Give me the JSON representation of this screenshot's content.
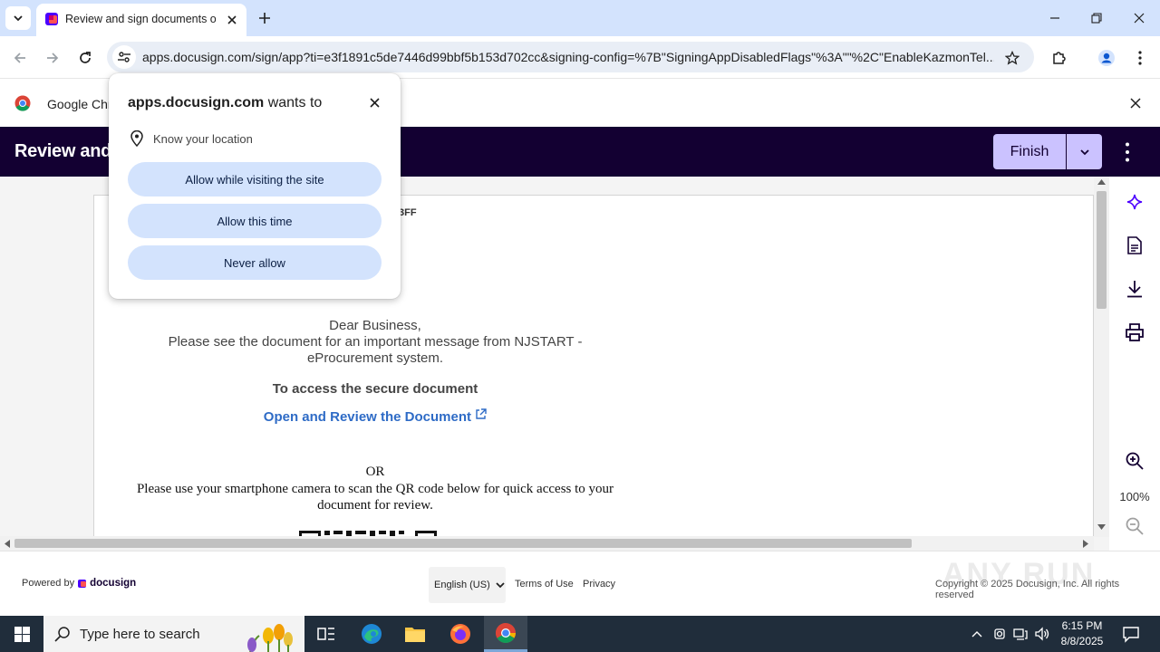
{
  "browser": {
    "tab": {
      "title": "Review and sign documents on"
    },
    "url": "apps.docusign.com/sign/app?ti=e3f1891c5de7446d99bbf5b153d702cc&signing-config=%7B\"SigningAppDisabledFlags\"%3A\"\"%2C\"EnableKazmonTel...",
    "infobar": {
      "text": "Google Chrome"
    }
  },
  "permission_popup": {
    "domain": "apps.docusign.com",
    "wants_to": " wants to",
    "permission": "Know your location",
    "buttons": {
      "allow_visiting": "Allow while visiting the site",
      "allow_once": "Allow this time",
      "never": "Never allow"
    }
  },
  "docusign": {
    "header_title": "Review and sign documents",
    "finish_label": "Finish",
    "document": {
      "code_fragment": "3FF",
      "greeting": "Dear Business,",
      "message": "Please see the document for an important message from NJSTART - eProcurement system.",
      "access_heading": "To access the secure document",
      "link_text": "Open and Review the Document",
      "or_text": "OR",
      "qr_instructions": "Please use your smartphone camera to scan the QR code below for quick access to your document for review."
    },
    "zoom_level": "100%",
    "footer": {
      "powered_by": "Powered by",
      "brand": "docusign",
      "language": "English (US)",
      "terms": "Terms of Use",
      "privacy": "Privacy",
      "copyright": "Copyright © 2025 Docusign, Inc. All rights reserved",
      "watermark": "ANY RUN"
    }
  },
  "taskbar": {
    "search_placeholder": "Type here to search",
    "time": "6:15 PM",
    "date": "8/8/2025"
  },
  "colors": {
    "docusign_header": "#130032",
    "finish_button": "#cbc2ff",
    "chrome_tabstrip": "#d3e3fd",
    "link": "#2e6bc6",
    "taskbar": "#202d3b"
  }
}
